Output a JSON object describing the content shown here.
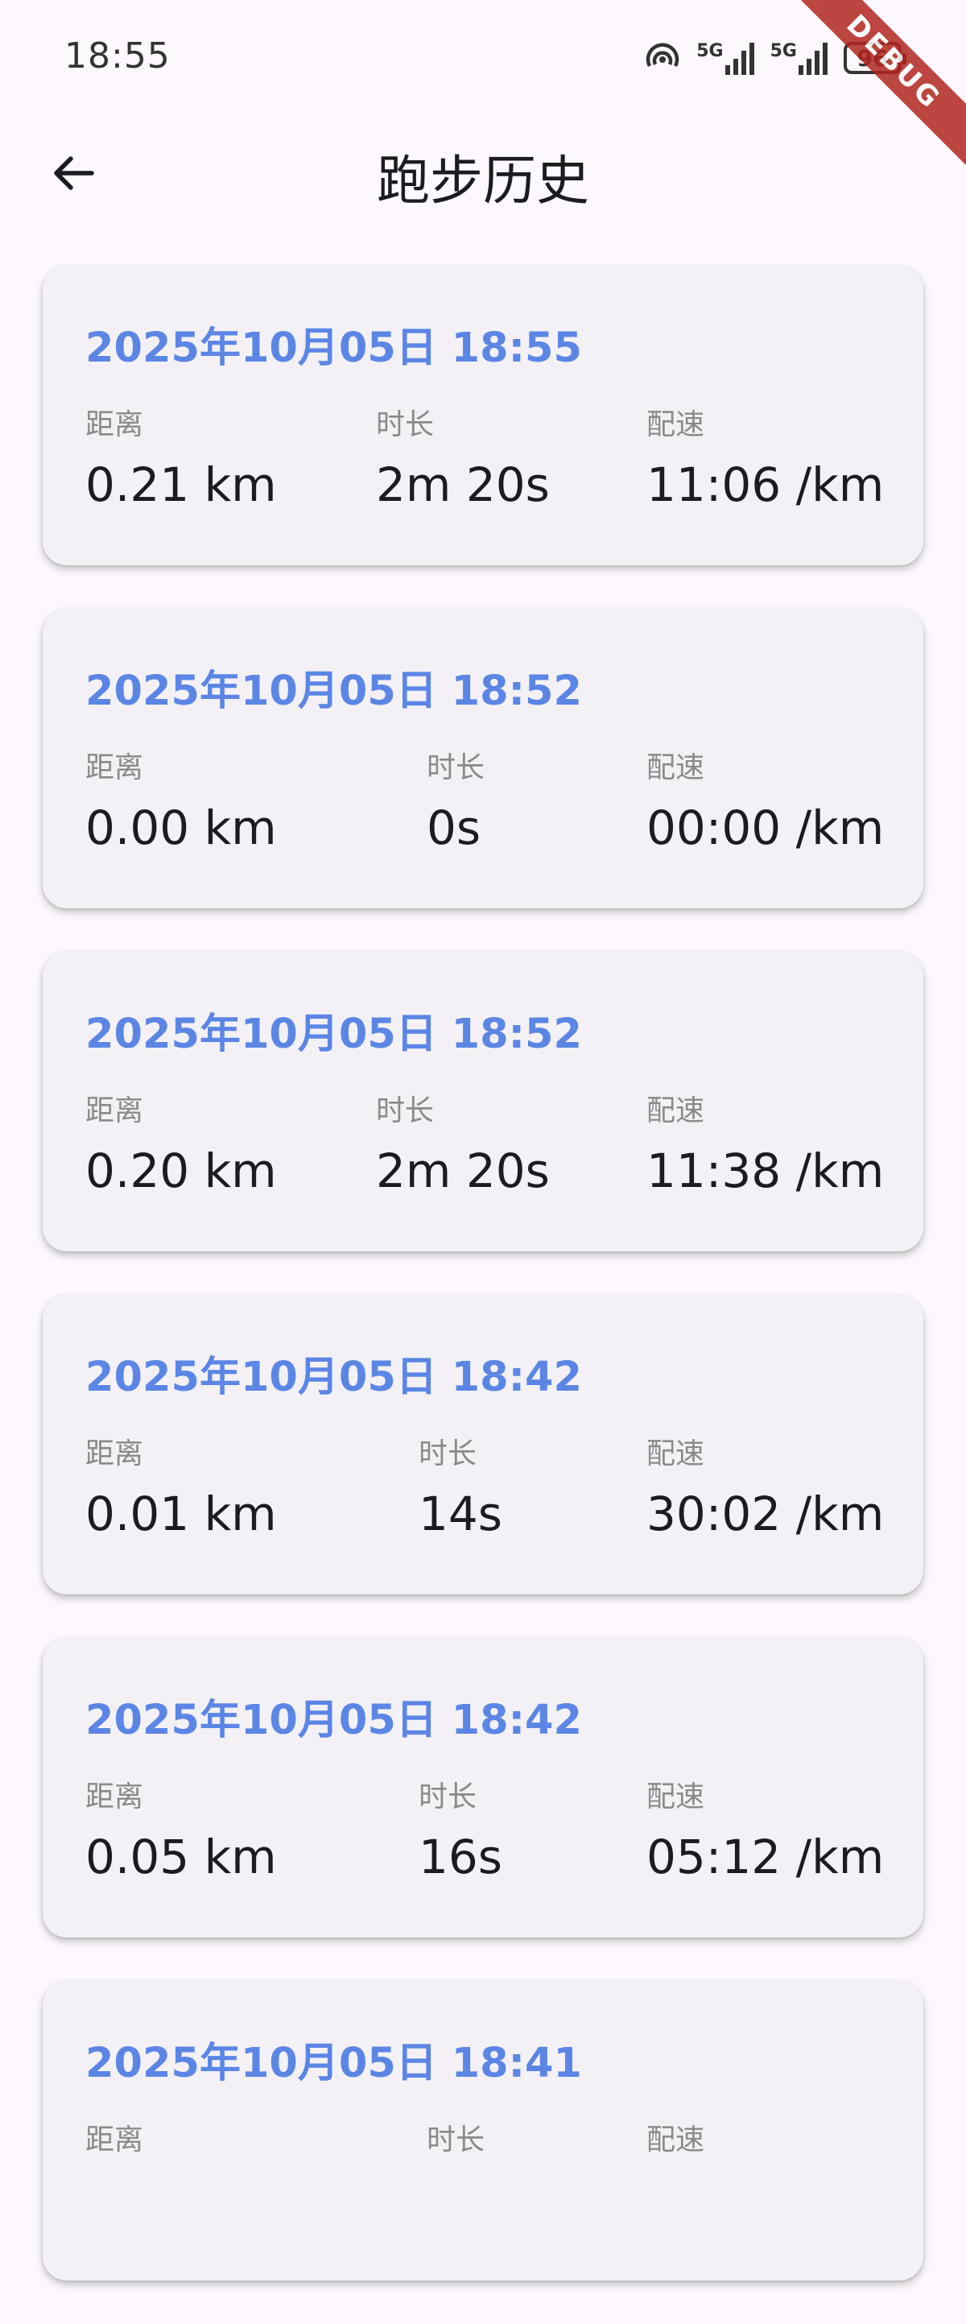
{
  "status_bar": {
    "time": "18:55",
    "network_1": "5G",
    "network_2": "5G",
    "battery": "96"
  },
  "debug_banner": "DEBUG",
  "app_bar": {
    "title": "跑步历史",
    "back_icon": "arrow-back-icon"
  },
  "labels": {
    "distance": "距离",
    "duration": "时长",
    "pace": "配速"
  },
  "runs": [
    {
      "date": "2025年10月05日 18:55",
      "distance": "0.21 km",
      "duration": "2m 20s",
      "pace": "11:06 /km"
    },
    {
      "date": "2025年10月05日 18:52",
      "distance": "0.00 km",
      "duration": "0s",
      "pace": "00:00 /km"
    },
    {
      "date": "2025年10月05日 18:52",
      "distance": "0.20 km",
      "duration": "2m 20s",
      "pace": "11:38 /km"
    },
    {
      "date": "2025年10月05日 18:42",
      "distance": "0.01 km",
      "duration": "14s",
      "pace": "30:02 /km"
    },
    {
      "date": "2025年10月05日 18:42",
      "distance": "0.05 km",
      "duration": "16s",
      "pace": "05:12 /km"
    },
    {
      "date": "2025年10月05日 18:41",
      "distance": "",
      "duration": "",
      "pace": ""
    }
  ],
  "colors": {
    "date_accent": "#5b86e5",
    "background": "#fcf8fd",
    "card": "#f4f1f6",
    "debug_ribbon": "#b3261e"
  }
}
